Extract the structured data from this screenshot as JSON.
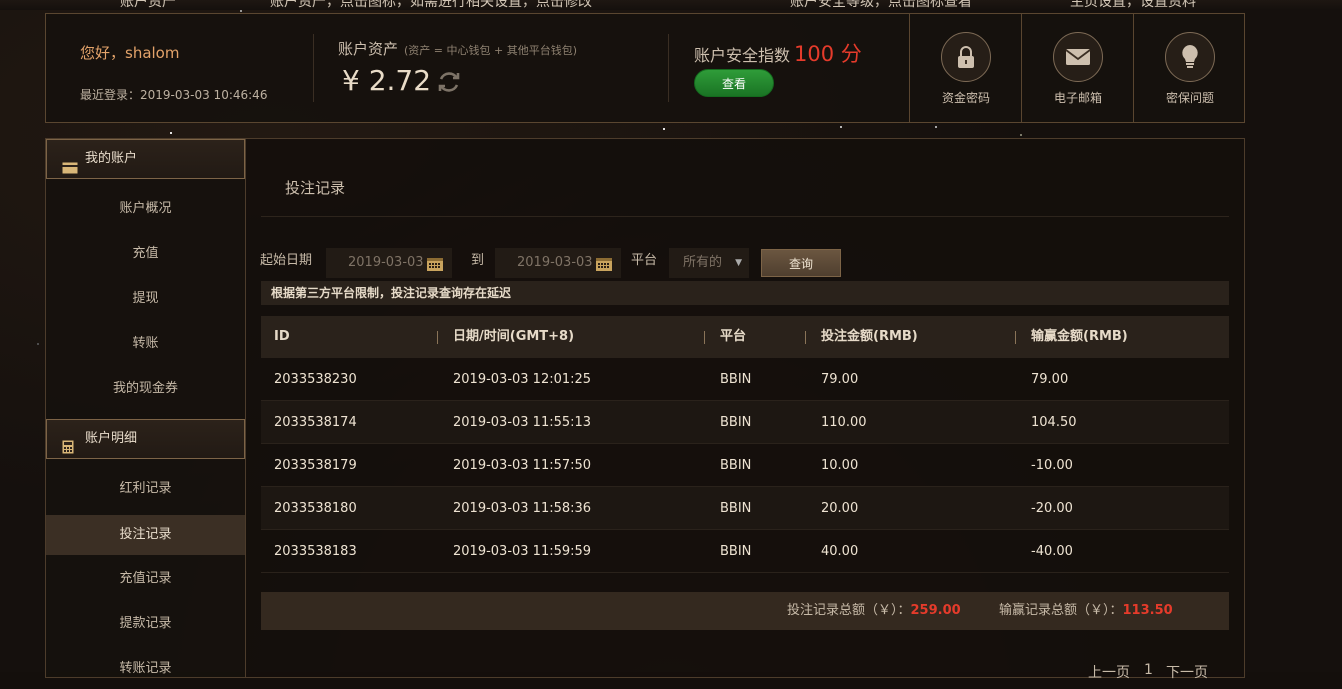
{
  "topstrip": {
    "text1": "账户资产",
    "text2": "账户资产，点击图标，如需进行相关设置，点击修改",
    "text3": "账户安全等级，点击图标查看",
    "text4": "主页设置，设置资料"
  },
  "header": {
    "greeting": "您好，shalom",
    "last_login": "最近登录：2019-03-03 10:46:46",
    "assets_label": "账户资产",
    "assets_note": "(资产 = 中心钱包 + 其他平台钱包)",
    "assets_value": "¥ 2.72",
    "security_label": "账户安全指数",
    "security_score": "100 分",
    "check_label": "查看",
    "quick_links": [
      {
        "label": "资金密码",
        "icon": "lock-icon"
      },
      {
        "label": "电子邮箱",
        "icon": "mail-icon"
      },
      {
        "label": "密保问题",
        "icon": "bulb-icon"
      }
    ]
  },
  "sidebar": {
    "section1": "我的账户",
    "items1": [
      "账户概况",
      "充值",
      "提现",
      "转账",
      "我的现金券"
    ],
    "section2": "账户明细",
    "items2": [
      "红利记录",
      "投注记录",
      "充值记录",
      "提款记录",
      "转账记录"
    ],
    "active": "投注记录"
  },
  "main": {
    "title": "投注记录",
    "filter": {
      "start_label": "起始日期",
      "start_date": "2019-03-03",
      "to_label": "到",
      "end_date": "2019-03-03",
      "platform_label": "平台",
      "platform_value": "所有的",
      "query_label": "查询"
    },
    "notice": "根据第三方平台限制，投注记录查询存在延迟",
    "table": {
      "headers": [
        "ID",
        "日期/时间(GMT+8)",
        "平台",
        "投注金额(RMB)",
        "输赢金额(RMB)"
      ],
      "rows": [
        [
          "2033538230",
          "2019-03-03 12:01:25",
          "BBIN",
          "79.00",
          "79.00"
        ],
        [
          "2033538174",
          "2019-03-03 11:55:13",
          "BBIN",
          "110.00",
          "104.50"
        ],
        [
          "2033538179",
          "2019-03-03 11:57:50",
          "BBIN",
          "10.00",
          "-10.00"
        ],
        [
          "2033538180",
          "2019-03-03 11:58:36",
          "BBIN",
          "20.00",
          "-20.00"
        ],
        [
          "2033538183",
          "2019-03-03 11:59:59",
          "BBIN",
          "40.00",
          "-40.00"
        ]
      ]
    },
    "summary": {
      "bet_label": "投注记录总额（￥）：",
      "bet_total": "259.00",
      "win_label": "输赢记录总额（￥）：",
      "win_total": "113.50"
    },
    "pager": {
      "prev": "上一页",
      "page": "1",
      "next": "下一页"
    }
  },
  "colors": {
    "accent_red": "#e53b2b",
    "accent_green": "#1f8a2c",
    "accent_orange": "#e3a36a",
    "border_gold": "#5a4630"
  }
}
